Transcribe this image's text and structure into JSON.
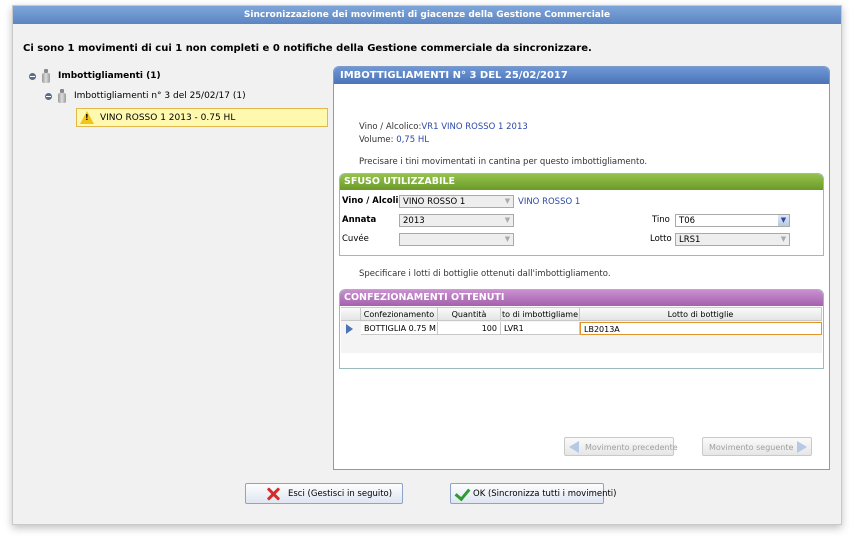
{
  "window": {
    "title": "Sincronizzazione dei movimenti di giacenze della Gestione Commerciale"
  },
  "summary": "Ci sono 1 movimenti di cui 1 non completi e 0 notifiche della Gestione commerciale da sincronizzare.",
  "tree": {
    "root": "Imbottigliamenti (1)",
    "child": "Imbottigliamenti n° 3 del 25/02/17  (1)",
    "leaf": "VINO ROSSO 1 2013  - 0.75 HL"
  },
  "panel": {
    "title": "IMBOTTIGLIAMENTI N° 3 DEL 25/02/2017",
    "wine_label": "Vino / Alcolico:",
    "wine_value": "VR1 VINO ROSSO 1 2013",
    "volume_label": "Volume: ",
    "volume_value": "0,75  HL",
    "instruction1": "Precisare i tini movimentati in cantina per questo imbottigliamento.",
    "instruction2": "Specificare i lotti di bottiglie ottenuti dall'imbottigliamento."
  },
  "sfuso": {
    "title": "SFUSO UTILIZZABILE",
    "vino_label": "Vino / Alcolic",
    "vino_value": "VINO ROSSO 1",
    "vino_link": "VINO ROSSO 1",
    "annata_label": "Annata",
    "annata_value": "2013",
    "cuvee_label": "Cuvée",
    "cuvee_value": "",
    "tino_label": "Tino",
    "tino_value": "T06",
    "lotto_label": "Lotto",
    "lotto_value": "LRS1"
  },
  "confezionamenti": {
    "title": "CONFEZIONAMENTI OTTENUTI",
    "columns": [
      "Confezionamento",
      "Quantità",
      "to di imbottigliame",
      "Lotto di bottiglie"
    ],
    "rows": [
      {
        "confezionamento": "BOTTIGLIA 0.75 M",
        "quantita": "100",
        "lotto_imb": "LVR1",
        "lotto_bottiglie": "LB2013A"
      }
    ]
  },
  "nav": {
    "prev": "Movimento precedente",
    "next": "Movimento seguente"
  },
  "buttons": {
    "exit": "Esci (Gestisci in seguito)",
    "ok": "OK (Sincronizza tutti i movimenti)"
  },
  "colors": {
    "title_blue": "#5b85c2",
    "green_header": "#6b9a2a",
    "pink_header": "#a461ad",
    "link_blue": "#2c48a8"
  }
}
